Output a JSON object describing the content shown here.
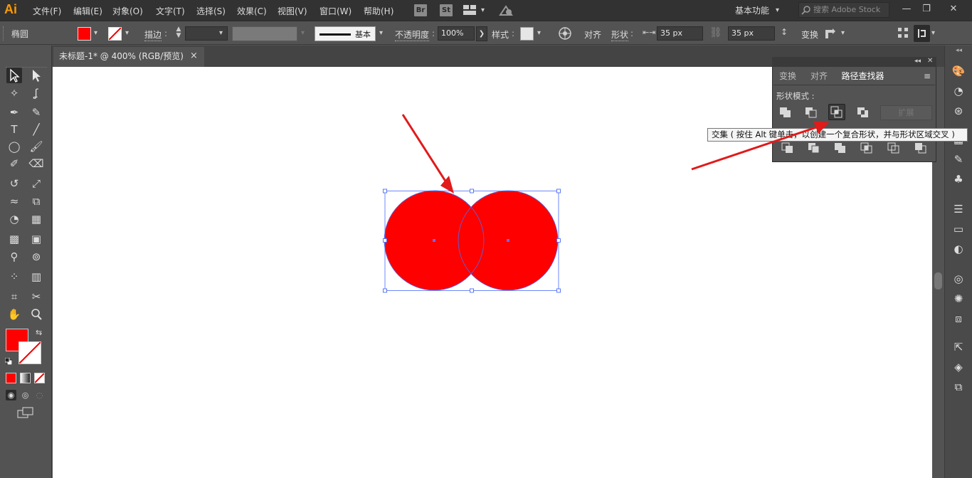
{
  "app": {
    "logo": "Ai"
  },
  "menu": [
    "文件(F)",
    "编辑(E)",
    "对象(O)",
    "文字(T)",
    "选择(S)",
    "效果(C)",
    "视图(V)",
    "窗口(W)",
    "帮助(H)"
  ],
  "bridge": {
    "br": "Br",
    "st": "St"
  },
  "workspace": "基本功能",
  "search": {
    "placeholder": "搜索 Adobe Stock"
  },
  "controlbar": {
    "object_type": "椭圆",
    "stroke_label": "描边",
    "opacity_label": "不透明度",
    "opacity_value": "100%",
    "brush_label": "基本",
    "style_label": "样式",
    "align_label": "对齐",
    "shape_label": "形状",
    "width_value": "35 px",
    "height_value": "35 px",
    "transform_label": "变换"
  },
  "document": {
    "tab_title": "未标题-1* @ 400% (RGB/预览)",
    "close": "×"
  },
  "panel": {
    "tabs": [
      "变换",
      "对齐",
      "路径查找器"
    ],
    "shape_modes_label": "形状模式 :",
    "expand_label": "扩展"
  },
  "tooltip": "交集 ( 按住 Alt 键单击，以创建一个复合形状，并与形状区域交叉 )",
  "colors": {
    "fill": "#ff0000",
    "accent": "#ff9a00",
    "selection": "#4a6cf7",
    "arrow": "#e11a1a"
  },
  "icons": {
    "selection": "selection-tool-icon",
    "direct": "direct-selection-icon",
    "pen": "pen-tool-icon",
    "type": "type-tool-icon",
    "ellipse": "ellipse-tool-icon",
    "hand": "hand-tool-icon",
    "zoom": "zoom-tool-icon"
  }
}
